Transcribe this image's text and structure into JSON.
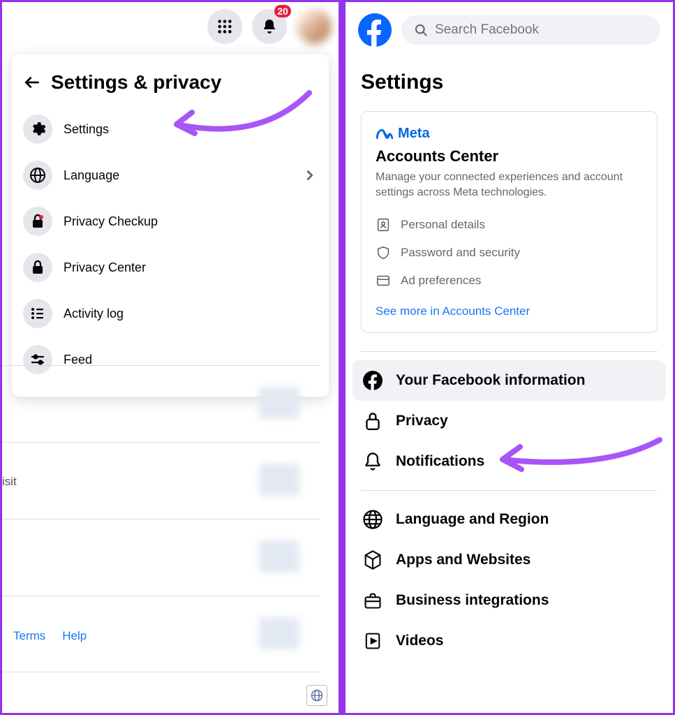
{
  "left": {
    "badge": "20",
    "menu_title": "Settings & privacy",
    "items": [
      {
        "label": "Settings",
        "icon": "gear",
        "chevron": false
      },
      {
        "label": "Language",
        "icon": "globe",
        "chevron": true
      },
      {
        "label": "Privacy Checkup",
        "icon": "lock-heart",
        "chevron": false
      },
      {
        "label": "Privacy Center",
        "icon": "lock",
        "chevron": false
      },
      {
        "label": "Activity log",
        "icon": "list",
        "chevron": false
      },
      {
        "label": "Feed",
        "icon": "sliders",
        "chevron": false
      }
    ],
    "bg_text": "isit",
    "footer": {
      "terms": "Terms",
      "help": "Help"
    }
  },
  "right": {
    "search_placeholder": "Search Facebook",
    "page_title": "Settings",
    "meta_brand": "Meta",
    "accounts_center": {
      "title": "Accounts Center",
      "desc": "Manage your connected experiences and account settings across Meta technologies.",
      "rows": [
        {
          "label": "Personal details"
        },
        {
          "label": "Password and security"
        },
        {
          "label": "Ad preferences"
        }
      ],
      "link": "See more in Accounts Center"
    },
    "group1": [
      {
        "label": "Your Facebook information",
        "icon": "fb-circle",
        "active": true
      },
      {
        "label": "Privacy",
        "icon": "padlock"
      },
      {
        "label": "Notifications",
        "icon": "bell"
      }
    ],
    "group2": [
      {
        "label": "Language and Region",
        "icon": "globe-grid"
      },
      {
        "label": "Apps and Websites",
        "icon": "cube"
      },
      {
        "label": "Business integrations",
        "icon": "briefcase"
      },
      {
        "label": "Videos",
        "icon": "video"
      }
    ]
  }
}
